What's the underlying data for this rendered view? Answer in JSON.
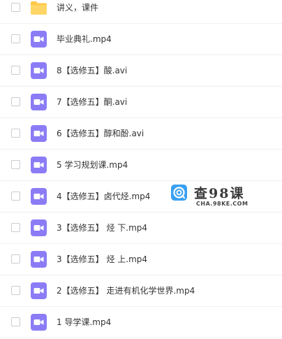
{
  "colors": {
    "folder": "#ffc94a",
    "video_icon": "#8b7cf6",
    "watermark_badge": "#3aa0f2"
  },
  "files": [
    {
      "name": "讲义，课件",
      "icon": "folder-icon"
    },
    {
      "name": "毕业典礼.mp4",
      "icon": "video-icon"
    },
    {
      "name": "8【选修五】酸.avi",
      "icon": "video-icon"
    },
    {
      "name": "7【选修五】酮.avi",
      "icon": "video-icon"
    },
    {
      "name": "6【选修五】醇和酚.avi",
      "icon": "video-icon"
    },
    {
      "name": "5 学习规划课.mp4",
      "icon": "video-icon"
    },
    {
      "name": "4【选修五】卤代烃.mp4",
      "icon": "video-icon"
    },
    {
      "name": "3【选修五】 烃 下.mp4",
      "icon": "video-icon"
    },
    {
      "name": "3【选修五】 烃 上.mp4",
      "icon": "video-icon"
    },
    {
      "name": "2【选修五】 走进有机化学世界.mp4",
      "icon": "video-icon"
    },
    {
      "name": "1 导学课.mp4",
      "icon": "video-icon"
    }
  ],
  "watermark": {
    "title": "查98课",
    "url": "CHA.98KE.COM"
  }
}
